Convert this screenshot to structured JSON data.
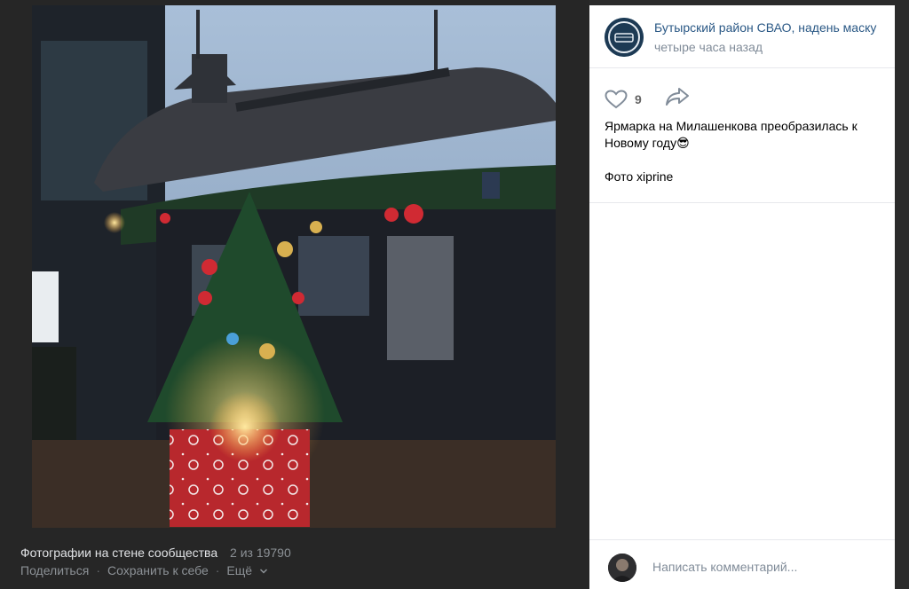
{
  "viewer": {
    "album_title": "Фотографии на стене сообщества",
    "counter": "2 из 19790",
    "actions": {
      "share": "Поделиться",
      "save": "Сохранить к себе",
      "more": "Ещё"
    }
  },
  "post": {
    "author": "Бутырский район СВАО, надень маску",
    "time": "четыре часа назад",
    "likes": "9",
    "text_line1": "Ярмарка на Милашенкова преобразилась к Новому году😎",
    "text_line2": "Фото xiprine"
  },
  "comment": {
    "placeholder": "Написать комментарий..."
  },
  "icons": {
    "like": "heart-icon",
    "share": "share-arrow-icon",
    "more": "chevron-down-icon"
  },
  "colors": {
    "link": "#2a5885",
    "muted": "#818c99",
    "viewer_bg": "#262626"
  }
}
